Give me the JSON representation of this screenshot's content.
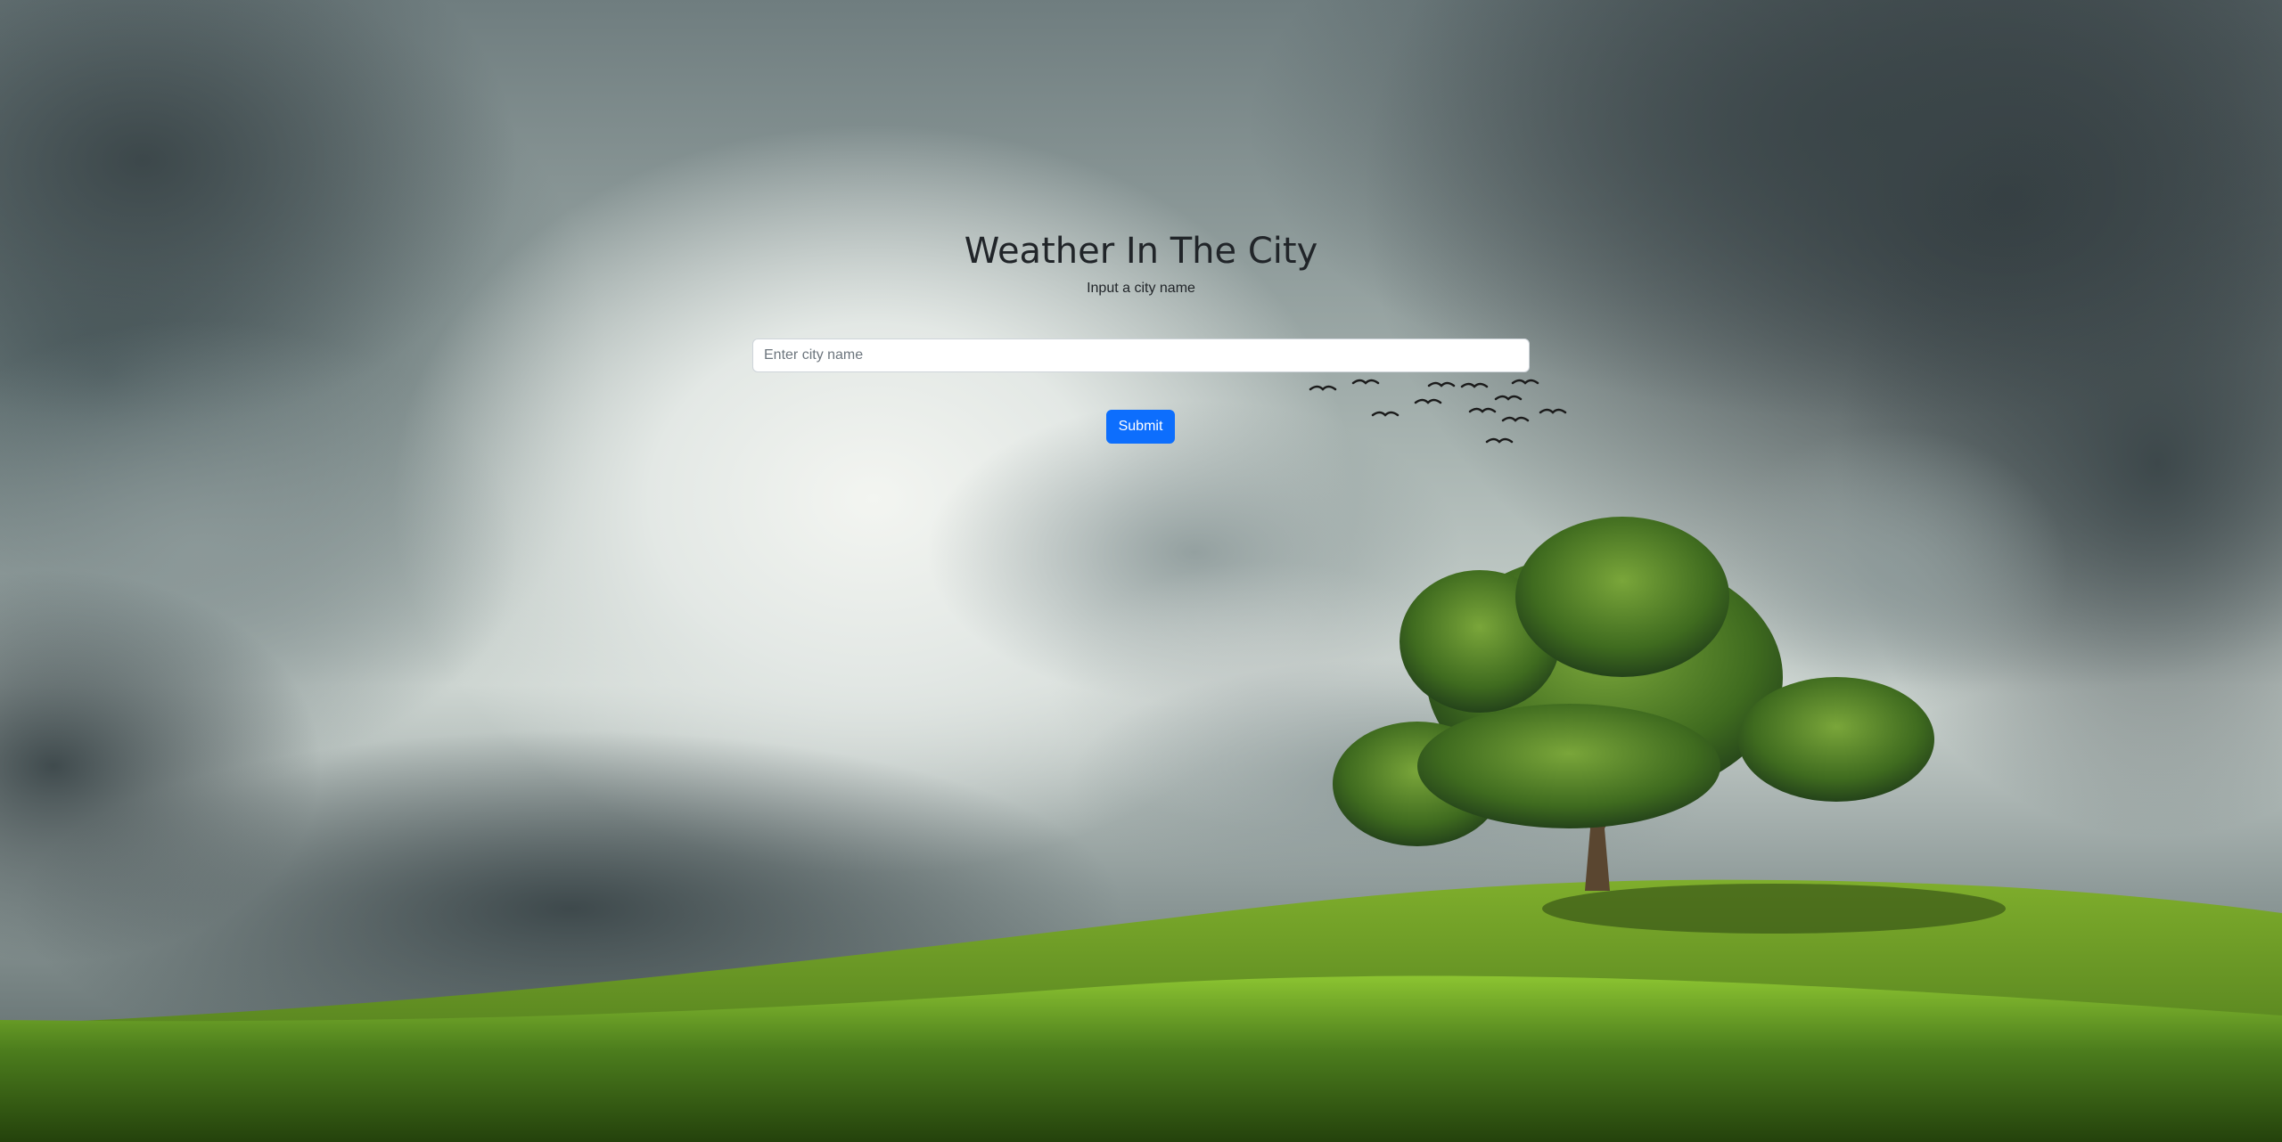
{
  "page": {
    "title": "Weather In The City",
    "subtitle": "Input a city name"
  },
  "search": {
    "placeholder": "Enter city name",
    "value": ""
  },
  "actions": {
    "submit_label": "Submit"
  },
  "colors": {
    "primary": "#0d6efd",
    "text": "#212529",
    "input_border": "#ced4da",
    "placeholder": "#6c757d"
  },
  "background": {
    "scene": "stormy-sky-with-tree-on-green-hill",
    "icons": [
      "cloud",
      "tree",
      "hill",
      "bird"
    ]
  }
}
